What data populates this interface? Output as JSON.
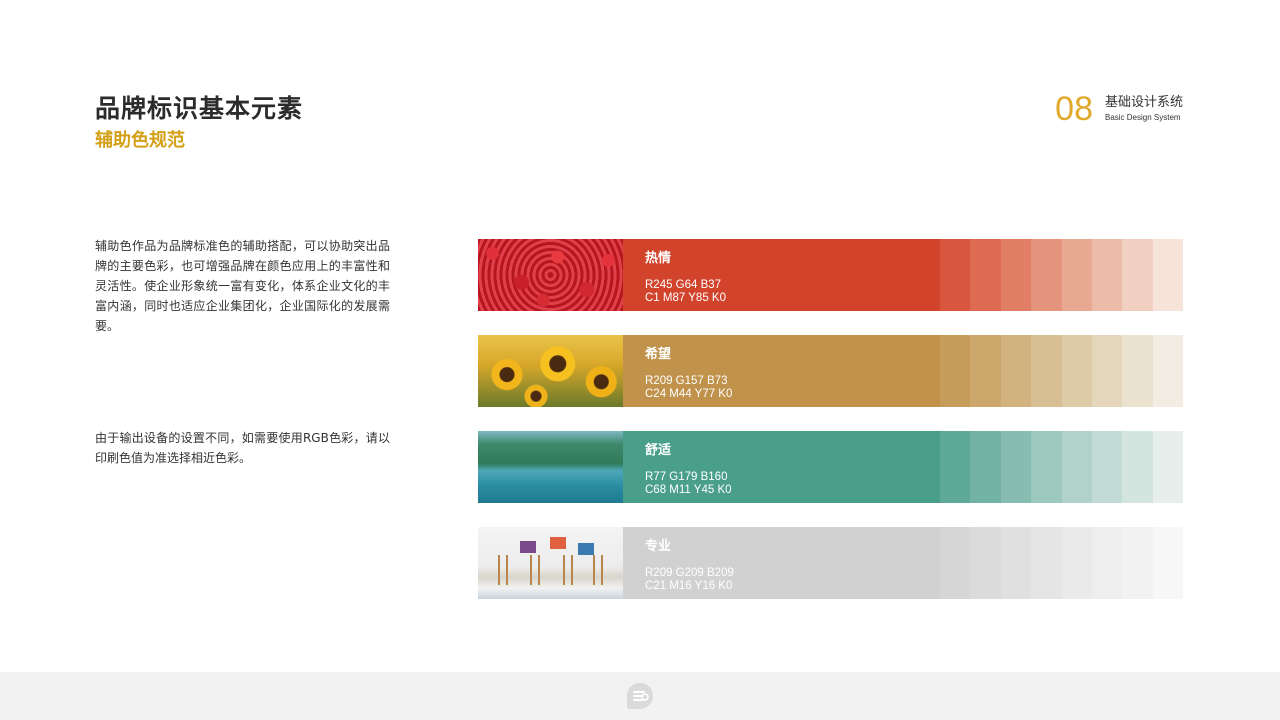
{
  "header": {
    "title": "品牌标识基本元素",
    "subtitle": "辅助色规范"
  },
  "section": {
    "number": "08",
    "name_cn": "基础设计系统",
    "name_en": "Basic Design System"
  },
  "description": {
    "paragraph_1": "辅助色作品为品牌标准色的辅助搭配，可以协助突出品牌的主要色彩，也可增强品牌在颜色应用上的丰富性和灵活性。使企业形象统一富有变化，体系企业文化的丰富内涵，同时也适应企业集团化，企业国际化的发展需要。",
    "paragraph_2": "由于输出设备的设置不同，如需要使用RGB色彩，请以印刷色值为准选择相近色彩。"
  },
  "palettes": [
    {
      "name": "热情",
      "rgb": "R245 G64 B37",
      "cmyk": "C1 M87 Y85 K0",
      "color": "#d2432c",
      "tints": [
        "#d8553e",
        "#dd6b52",
        "#e07f66",
        "#e4937c",
        "#e8a892",
        "#ecbca9",
        "#f1d0c2",
        "#f6e3da"
      ]
    },
    {
      "name": "希望",
      "rgb": "R209 G157 B73",
      "cmyk": "C24 M44 Y77 K0",
      "color": "#c0924b",
      "tints": [
        "#c69c5b",
        "#cca86c",
        "#d2b37f",
        "#d8bf93",
        "#decba7",
        "#e4d6bb",
        "#eae1cf",
        "#f2ece2"
      ]
    },
    {
      "name": "舒适",
      "rgb": "R77 G179 B160",
      "cmyk": "C68 M11 Y45 K0",
      "color": "#4a9f8b",
      "tints": [
        "#5ea997",
        "#73b3a4",
        "#87bdb0",
        "#9cc8bd",
        "#b0d2c9",
        "#c2dbd5",
        "#d4e5e0",
        "#e6efec"
      ]
    },
    {
      "name": "专业",
      "rgb": "R209 G209 B209",
      "cmyk": "C21 M16 Y16 K0",
      "color": "#d1d1d1",
      "tints": [
        "#d6d6d6",
        "#dbdbdb",
        "#e0e0e0",
        "#e5e5e5",
        "#eaeaea",
        "#eeeeee",
        "#f2f2f2",
        "#f7f7f7"
      ]
    }
  ],
  "footer": {
    "logo_icon": "brand-logo-icon"
  }
}
